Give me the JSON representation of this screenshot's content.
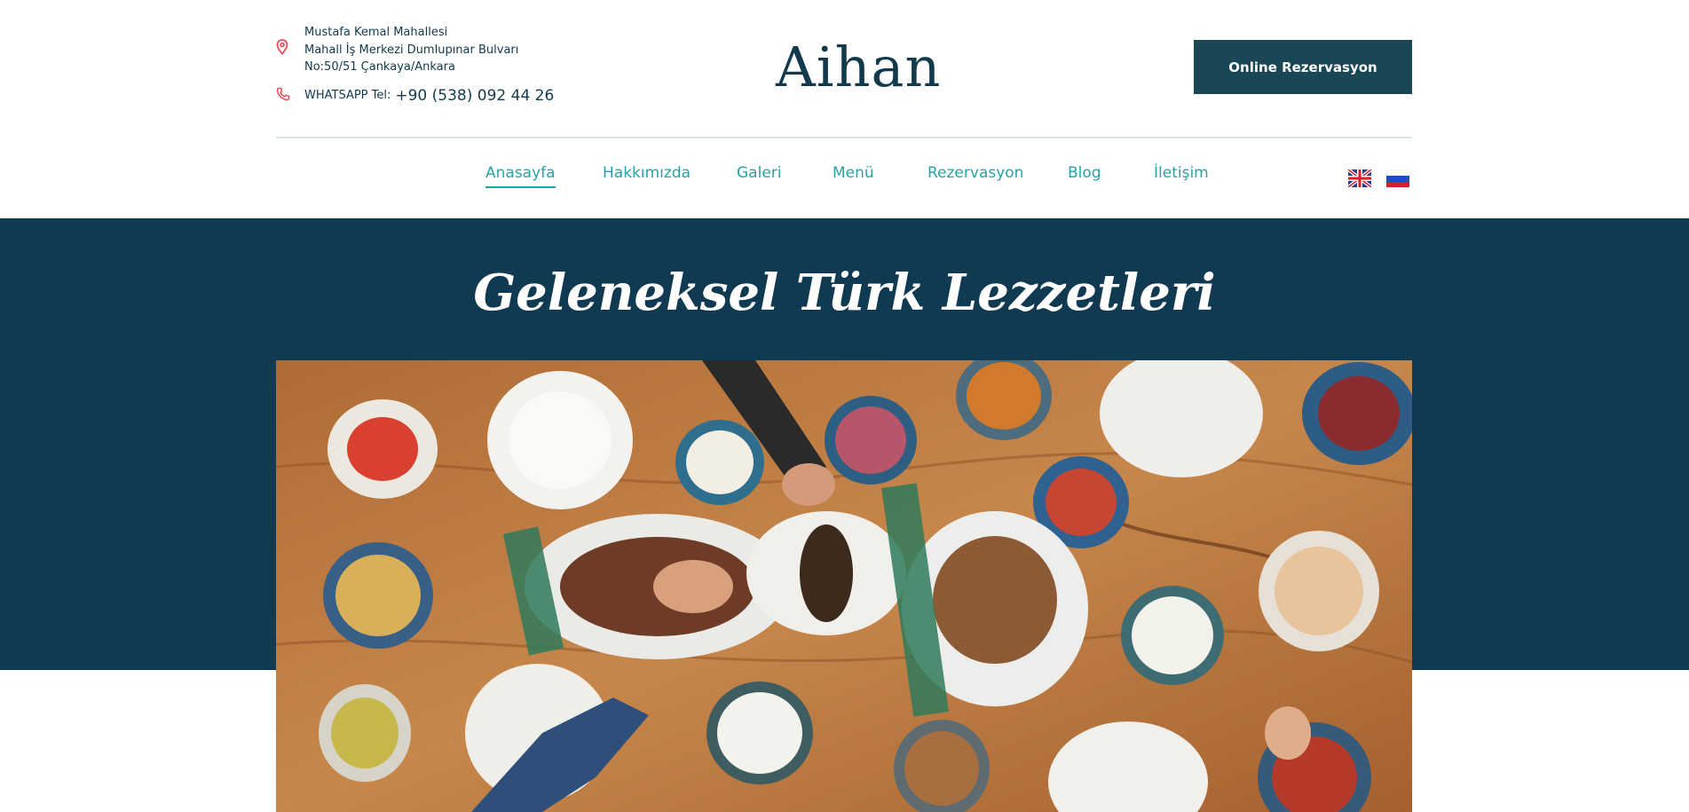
{
  "header": {
    "address_lines": [
      "Mustafa Kemal Mahallesi",
      "Mahall İş Merkezi Dumlupınar Bulvarı",
      "No:50/51 Çankaya/Ankara"
    ],
    "phone_label": "WHATSAPP Tel:",
    "phone_number": "+90 (538) 092 44 26",
    "logo_text": "Aihan",
    "reserve_button": "Online Rezervasyon",
    "icons": {
      "location": "map-pin-icon",
      "phone": "phone-icon"
    },
    "accent_color": "#e94c57"
  },
  "nav": {
    "items": [
      "Anasayfa",
      "Hakkımızda",
      "Galeri",
      "Menü",
      "Rezervasyon",
      "Blog",
      "İletişim"
    ],
    "active": "Anasayfa",
    "languages": [
      "English",
      "Русский"
    ],
    "link_color": "#24a4a7"
  },
  "hero": {
    "title": "Geleneksel Türk Lezzetleri",
    "background": "#0f3a51"
  }
}
